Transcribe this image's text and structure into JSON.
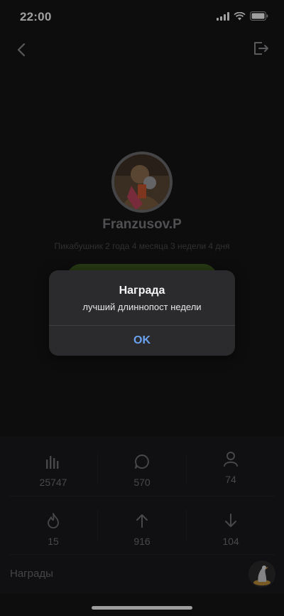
{
  "status_bar": {
    "time": "22:00"
  },
  "profile": {
    "username": "Franzusov.P",
    "tenure": "Пикабушник 2 года 4 месяца 3 недели 4 дня"
  },
  "stats": [
    {
      "icon": "bar-chart-icon",
      "value": "25747"
    },
    {
      "icon": "comment-icon",
      "value": "570"
    },
    {
      "icon": "person-icon",
      "value": "74"
    },
    {
      "icon": "fire-icon",
      "value": "15"
    },
    {
      "icon": "arrow-up-icon",
      "value": "916"
    },
    {
      "icon": "arrow-down-icon",
      "value": "104"
    }
  ],
  "awards": {
    "label": "Награды"
  },
  "alert": {
    "title": "Награда",
    "message": "лучший длиннопост недели",
    "ok_label": "OK"
  },
  "colors": {
    "background": "#141415",
    "alert_background": "#2b2b2d",
    "accent_blue": "#6aa2f0",
    "green_button": "#3d5a1f"
  }
}
